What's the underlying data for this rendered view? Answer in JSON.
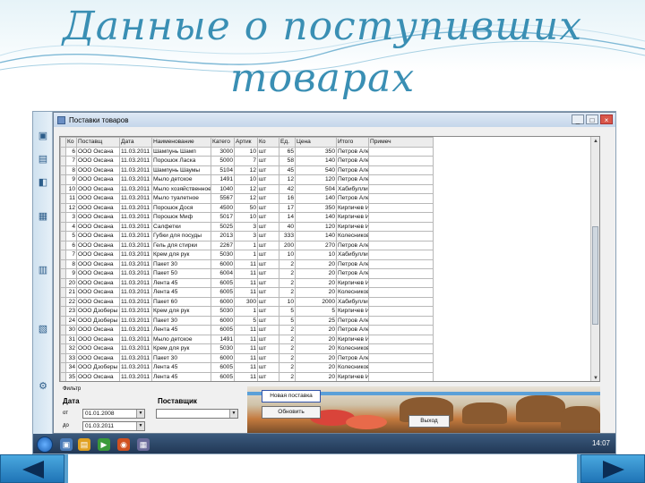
{
  "slide": {
    "title_line1": "Данные о поступивших",
    "title_line2": "товарах",
    "accent_color": "#3a8fb4"
  },
  "window": {
    "title": "Поставки товаров",
    "minimize": "_",
    "maximize": "□",
    "close": "×"
  },
  "grid": {
    "columns": [
      "Ко",
      "Поставщ",
      "Дата",
      "Наименование",
      "Катего",
      "Артик",
      "Ко",
      "Ед.",
      "Цена",
      "Итого",
      "Примеч"
    ],
    "rows": [
      [
        "6",
        "ООО Оксана",
        "11.03.2011",
        "Шампунь Шамп",
        "3000",
        "10",
        "шт",
        "65",
        "350",
        "Петров Алексан"
      ],
      [
        "7",
        "ООО Оксана",
        "11.03.2011",
        "Порошок Ласка",
        "5000",
        "7",
        "шт",
        "58",
        "140",
        "Петров Алексан"
      ],
      [
        "8",
        "ООО Оксана",
        "11.03.2011",
        "Шампунь Шаумы",
        "5104",
        "12",
        "шт",
        "45",
        "540",
        "Петров Алексан"
      ],
      [
        "9",
        "ООО Оксана",
        "11.03.2011",
        "Мыло детское",
        "1491",
        "10",
        "шт",
        "12",
        "120",
        "Петров Алексан"
      ],
      [
        "10",
        "ООО Оксана",
        "11.03.2011",
        "Мыло хозяйственное",
        "1040",
        "12",
        "шт",
        "42",
        "504",
        "Хабибуллина А"
      ],
      [
        "11",
        "ООО Оксана",
        "11.03.2011",
        "Мыло туалетное",
        "5567",
        "12",
        "шт",
        "16",
        "140",
        "Петров Алексан"
      ],
      [
        "12",
        "ООО Оксана",
        "11.03.2011",
        "Порошок Дося",
        "4500",
        "50",
        "шт",
        "17",
        "350",
        "Кирпичев Иван"
      ],
      [
        "3",
        "ООО Оксана",
        "11.03.2011",
        "Порошок Миф",
        "5017",
        "10",
        "шт",
        "14",
        "140",
        "Кирпичев Иван"
      ],
      [
        "4",
        "ООО Оксана",
        "11.03.2011",
        "Салфетки",
        "5025",
        "3",
        "шт",
        "40",
        "120",
        "Кирпичев Иван"
      ],
      [
        "5",
        "ООО Оксана",
        "11.03.2011",
        "Губки для посуды",
        "2013",
        "3",
        "шт",
        "333",
        "140",
        "Колесникова А"
      ],
      [
        "6",
        "ООО Оксана",
        "11.03.2011",
        "Гель для стирки",
        "2267",
        "1",
        "шт",
        "200",
        "270",
        "Петров Алексан"
      ],
      [
        "7",
        "ООО Оксана",
        "11.03.2011",
        "Крем для рук",
        "5030",
        "1",
        "шт",
        "10",
        "10",
        "Хабибуллина А"
      ],
      [
        "8",
        "ООО Оксана",
        "11.03.2011",
        "Пакет 30",
        "6000",
        "11",
        "шт",
        "2",
        "20",
        "Петров Алексан"
      ],
      [
        "9",
        "ООО Оксана",
        "11.03.2011",
        "Пакет 50",
        "6004",
        "11",
        "шт",
        "2",
        "20",
        "Петров Алексан"
      ],
      [
        "20",
        "ООО Оксана",
        "11.03.2011",
        "Лента 45",
        "6005",
        "11",
        "шт",
        "2",
        "20",
        "Кирпичев Иван"
      ],
      [
        "21",
        "ООО Оксана",
        "11.03.2011",
        "Лента 45",
        "6005",
        "11",
        "шт",
        "2",
        "20",
        "Колесникова А"
      ],
      [
        "22",
        "ООО Оксана",
        "11.03.2011",
        "Пакет 60",
        "6000",
        "300",
        "шт",
        "10",
        "2000",
        "Хабибуллина А"
      ],
      [
        "23",
        "ООО Дзоберы",
        "11.03.2011",
        "Крем для рук",
        "5030",
        "1",
        "шт",
        "5",
        "5",
        "Кирпичев Иван"
      ],
      [
        "24",
        "ООО Дзоберы",
        "11.03.2011",
        "Пакет 30",
        "6000",
        "5",
        "шт",
        "5",
        "25",
        "Петров Алексан"
      ],
      [
        "30",
        "ООО Оксана",
        "11.03.2011",
        "Лента 45",
        "6005",
        "11",
        "шт",
        "2",
        "20",
        "Петров Алексан"
      ],
      [
        "31",
        "ООО Оксана",
        "11.03.2011",
        "Мыло детское",
        "1491",
        "11",
        "шт",
        "2",
        "20",
        "Кирпичев Иван"
      ],
      [
        "32",
        "ООО Оксана",
        "11.03.2011",
        "Крем для рук",
        "5030",
        "11",
        "шт",
        "2",
        "20",
        "Колесникова А"
      ],
      [
        "33",
        "ООО Оксана",
        "11.03.2011",
        "Пакет 30",
        "6000",
        "11",
        "шт",
        "2",
        "20",
        "Петров Алексан"
      ],
      [
        "34",
        "ООО Дзоберы",
        "11.03.2011",
        "Лента 45",
        "6005",
        "11",
        "шт",
        "2",
        "20",
        "Колесникова А"
      ],
      [
        "35",
        "ООО Оксана",
        "11.03.2011",
        "Лента 45",
        "6005",
        "11",
        "шт",
        "2",
        "20",
        "Кирпичев Иван"
      ]
    ]
  },
  "filter": {
    "label": "Фильтр",
    "date_label": "Дата",
    "supplier_label": "Поставщик",
    "from_label": "от",
    "to_label": "до",
    "date_from": "01.01.2008",
    "date_to": "01.03.2011",
    "supplier_value": "",
    "btn_new": "Новая поставка",
    "btn_refresh": "Обновить",
    "btn_exit": "Выход"
  },
  "taskbar": {
    "clock": "14:07"
  },
  "nav": {
    "prev": "previous",
    "next": "next"
  }
}
